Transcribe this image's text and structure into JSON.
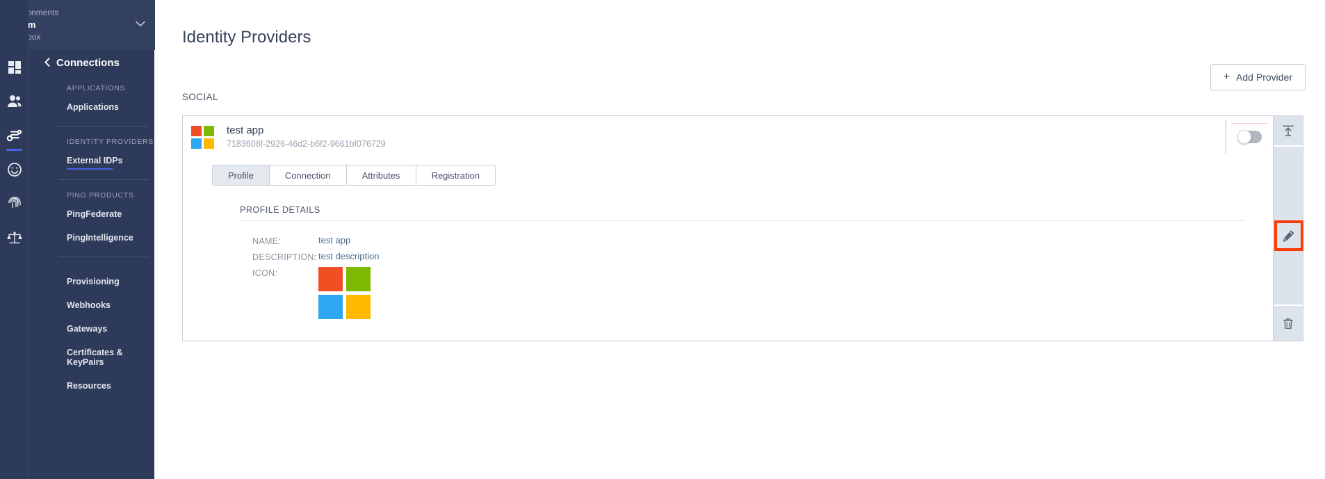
{
  "environment": {
    "label": "Environments",
    "name": "Maxim",
    "type": "Sandbox",
    "chevron_icon": "chevron-down-icon"
  },
  "icon_rail": [
    {
      "name": "dashboard-icon",
      "active": false
    },
    {
      "name": "users-icon",
      "active": false
    },
    {
      "name": "connections-icon",
      "active": true
    },
    {
      "name": "experiences-icon",
      "active": false
    },
    {
      "name": "authentication-icon",
      "active": false
    },
    {
      "name": "compliance-icon",
      "active": false
    }
  ],
  "nav": {
    "back_label": "Connections",
    "back_icon": "chevron-left-icon",
    "sections": [
      {
        "heading": "APPLICATIONS",
        "items": [
          {
            "label": "Applications",
            "selected": false
          }
        ]
      },
      {
        "heading": "IDENTITY PROVIDERS",
        "items": [
          {
            "label": "External IDPs",
            "selected": true
          }
        ]
      },
      {
        "heading": "PING PRODUCTS",
        "items": [
          {
            "label": "PingFederate",
            "selected": false
          },
          {
            "label": "PingIntelligence",
            "selected": false
          }
        ]
      },
      {
        "heading": "",
        "items": [
          {
            "label": "Provisioning",
            "selected": false
          },
          {
            "label": "Webhooks",
            "selected": false
          },
          {
            "label": "Gateways",
            "selected": false
          },
          {
            "label": "Certificates & KeyPairs",
            "selected": false
          },
          {
            "label": "Resources",
            "selected": false
          }
        ]
      }
    ]
  },
  "main": {
    "page_title": "Identity Providers",
    "add_provider_label": "Add Provider",
    "add_provider_icon": "plus-icon",
    "group_label": "SOCIAL"
  },
  "provider_card": {
    "logo_icon": "microsoft-squares-icon",
    "name": "test app",
    "id": "7183608f-2926-46d2-b6f2-9661bf076729",
    "enabled_toggle": {
      "name": "enable-provider-toggle",
      "state": "off"
    },
    "tabs": [
      {
        "label": "Profile",
        "active": true
      },
      {
        "label": "Connection",
        "active": false
      },
      {
        "label": "Attributes",
        "active": false
      },
      {
        "label": "Registration",
        "active": false
      }
    ],
    "details": {
      "section_title": "PROFILE DETAILS",
      "rows": [
        {
          "label": "NAME:",
          "value": "test app"
        },
        {
          "label": "DESCRIPTION:",
          "value": "test description"
        },
        {
          "label": "ICON:",
          "value": ""
        }
      ]
    },
    "actions": [
      {
        "name": "upload-icon",
        "label": "upload"
      },
      {
        "name": "edit-icon",
        "label": "edit",
        "highlighted": true
      },
      {
        "name": "delete-icon",
        "label": "delete"
      }
    ]
  },
  "colors": {
    "nav_bg": "#2e3a59",
    "env_bg": "#33405f",
    "accent_blue": "#4a62e8",
    "rail_bg": "#dde3ea",
    "highlight_red": "#fa3c0a",
    "logo_red": "#f04e23",
    "logo_green": "#7cb900",
    "logo_blue": "#2da7ef",
    "logo_yellow": "#ffb900"
  }
}
